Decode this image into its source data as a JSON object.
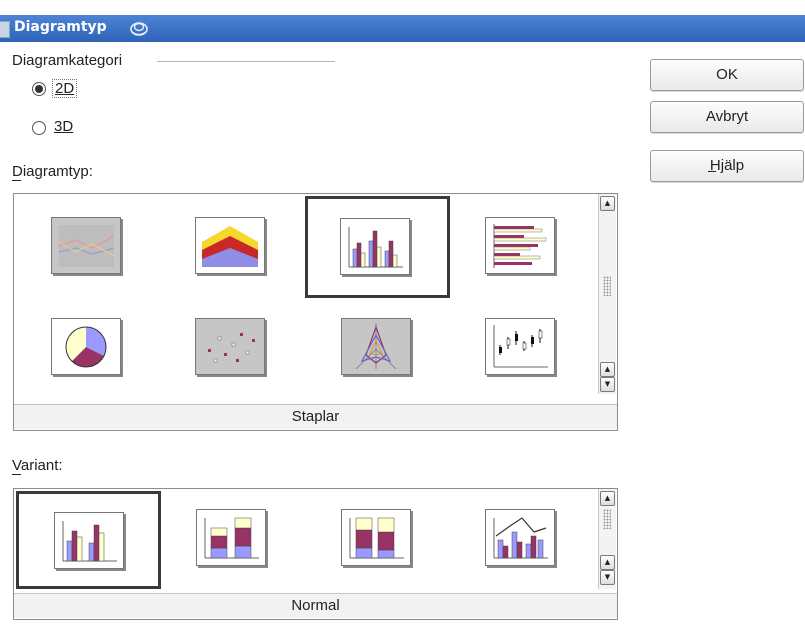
{
  "dialog": {
    "title": "Diagramtyp"
  },
  "category": {
    "group_label": "Diagramkategori",
    "option_2d": "2D",
    "option_3d": "3D",
    "selected": "2D"
  },
  "types": {
    "label": "Diagramtyp:",
    "selected_name": "Staplar",
    "items": [
      "Linjer",
      "Ytor",
      "Staplar",
      "Liggande staplar",
      "Cirkel",
      "XY-diagram",
      "Nät",
      "Börsdiagram"
    ]
  },
  "variants": {
    "label": "Variant:",
    "selected_name": "Normal",
    "items": [
      "Normal",
      "Staplade",
      "Procent staplade",
      "Staplar och linjer"
    ]
  },
  "buttons": {
    "ok": "OK",
    "cancel": "Avbryt",
    "help": "Hjälp"
  },
  "colors": {
    "titlebar": "#3a72c8",
    "series_1": "#9999ff",
    "series_2": "#993366",
    "series_3": "#ffffcc",
    "series_4": "#ccffff"
  }
}
